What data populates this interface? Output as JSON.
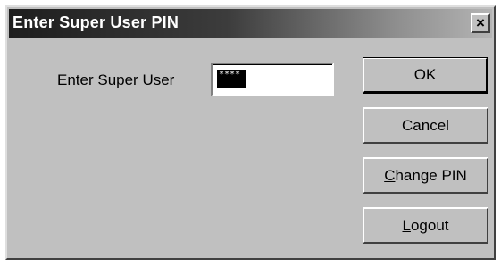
{
  "window": {
    "title": "Enter Super User PIN",
    "close_glyph": "×"
  },
  "form": {
    "prompt": "Enter Super User",
    "pin_masked": "****"
  },
  "buttons": {
    "ok": "OK",
    "cancel": "Cancel",
    "change_pin_accel": "C",
    "change_pin_rest": "hange PIN",
    "logout_accel": "L",
    "logout_rest": "ogout"
  }
}
